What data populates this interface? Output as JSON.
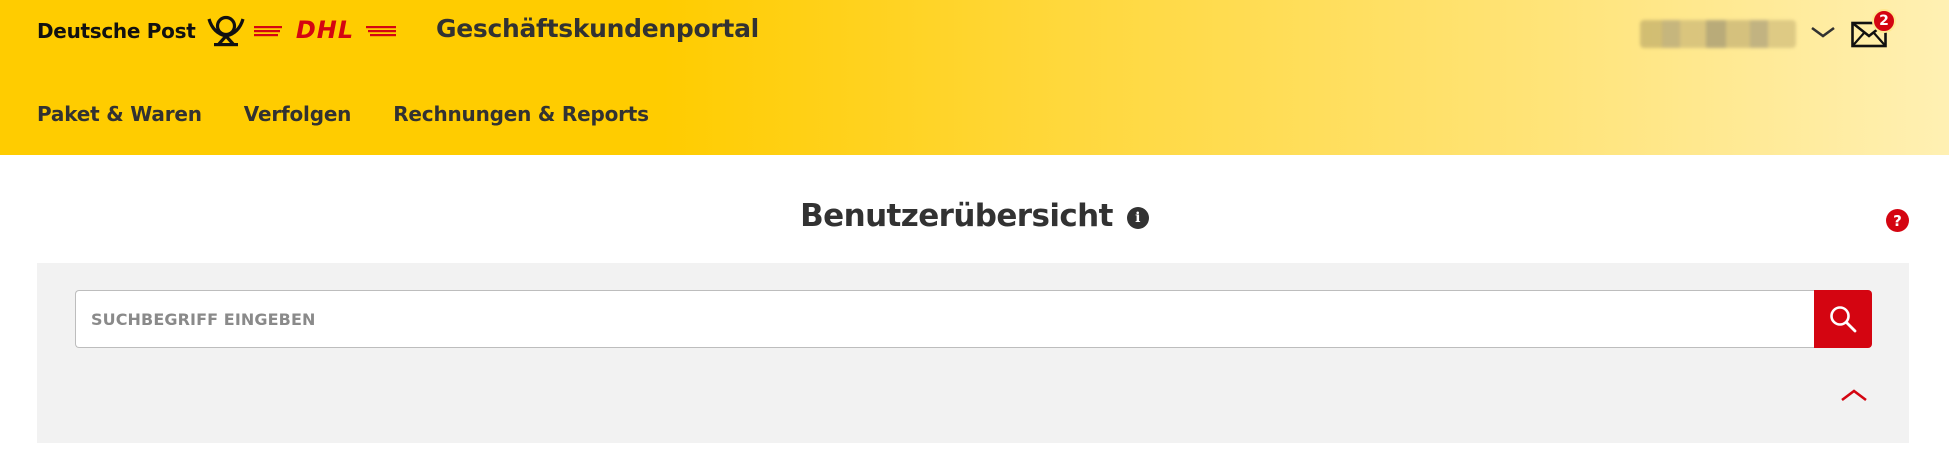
{
  "header": {
    "brand_name": "Deutsche Post",
    "dhl_logo": "DHL",
    "portal_title": "Geschäftskundenportal",
    "mail_badge_count": "2"
  },
  "nav": {
    "items": [
      {
        "label": "Paket & Waren"
      },
      {
        "label": "Verfolgen"
      },
      {
        "label": "Rechnungen & Reports"
      }
    ]
  },
  "main": {
    "page_title": "Benutzerübersicht",
    "info_glyph": "i",
    "help_glyph": "?",
    "search": {
      "placeholder": "SUCHBEGRIFF EINGEBEN",
      "value": ""
    }
  },
  "colors": {
    "brand_yellow": "#ffcc00",
    "brand_red": "#d40511",
    "text_dark": "#323232",
    "panel_bg": "#f2f2f2"
  },
  "icons": {
    "post_horn": "post-horn-icon",
    "user_menu": "chevron-down-icon",
    "mail": "mail-icon",
    "info": "info-icon",
    "help": "help-icon",
    "search": "search-icon",
    "collapse": "chevron-up-icon"
  }
}
